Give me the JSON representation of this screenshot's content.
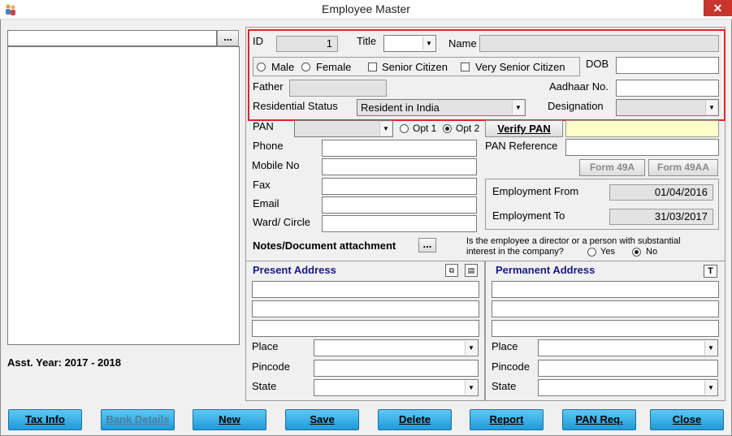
{
  "window": {
    "title": "Employee Master",
    "close_label": "✕"
  },
  "left_panel": {
    "search_value": "",
    "browse_label": "...",
    "asst_year": "Asst. Year: 2017 - 2018"
  },
  "form": {
    "id_label": "ID",
    "id_value": "1",
    "title_label": "Title",
    "title_value": "",
    "name_label": "Name",
    "name_value": "",
    "male_label": "Male",
    "female_label": "Female",
    "senior_label": "Senior Citizen",
    "very_senior_label": "Very Senior Citizen",
    "dob_label": "DOB",
    "dob_value": "",
    "father_label": "Father",
    "father_value": "",
    "aadhaar_label": "Aadhaar No.",
    "aadhaar_value": "",
    "res_status_label": "Residential Status",
    "res_status_value": "Resident in India",
    "designation_label": "Designation",
    "designation_value": "",
    "pan_label": "PAN",
    "pan_value": "",
    "opt1_label": "Opt 1",
    "opt2_label": "Opt 2",
    "verify_pan_label": "Verify PAN",
    "pan_reference_label": "PAN Reference",
    "phone_label": "Phone",
    "mobile_label": "Mobile No",
    "fax_label": "Fax",
    "email_label": "Email",
    "ward_label": "Ward/ Circle",
    "form49a_label": "Form 49A",
    "form49aa_label": "Form 49AA",
    "emp_from_label": "Employment From",
    "emp_from_value": "01/04/2016",
    "emp_to_label": "Employment To",
    "emp_to_value": "31/03/2017",
    "notes_label": "Notes/Document attachment",
    "notes_btn": "...",
    "director_question": "Is the employee a director or a person with substantial",
    "director_question2": "interest in the company?",
    "yes_label": "Yes",
    "no_label": "No"
  },
  "present_address": {
    "title": "Present Address",
    "place_label": "Place",
    "pincode_label": "Pincode",
    "state_label": "State"
  },
  "permanent_address": {
    "title": "Permanent Address",
    "t_label": "T",
    "place_label": "Place",
    "pincode_label": "Pincode",
    "state_label": "State"
  },
  "buttons": {
    "tax_info": "Tax Info",
    "bank_details": "Bank Details",
    "new": "New",
    "save": "Save",
    "delete": "Delete",
    "report": "Report",
    "pan_req": "PAN Req.",
    "close": "Close"
  }
}
